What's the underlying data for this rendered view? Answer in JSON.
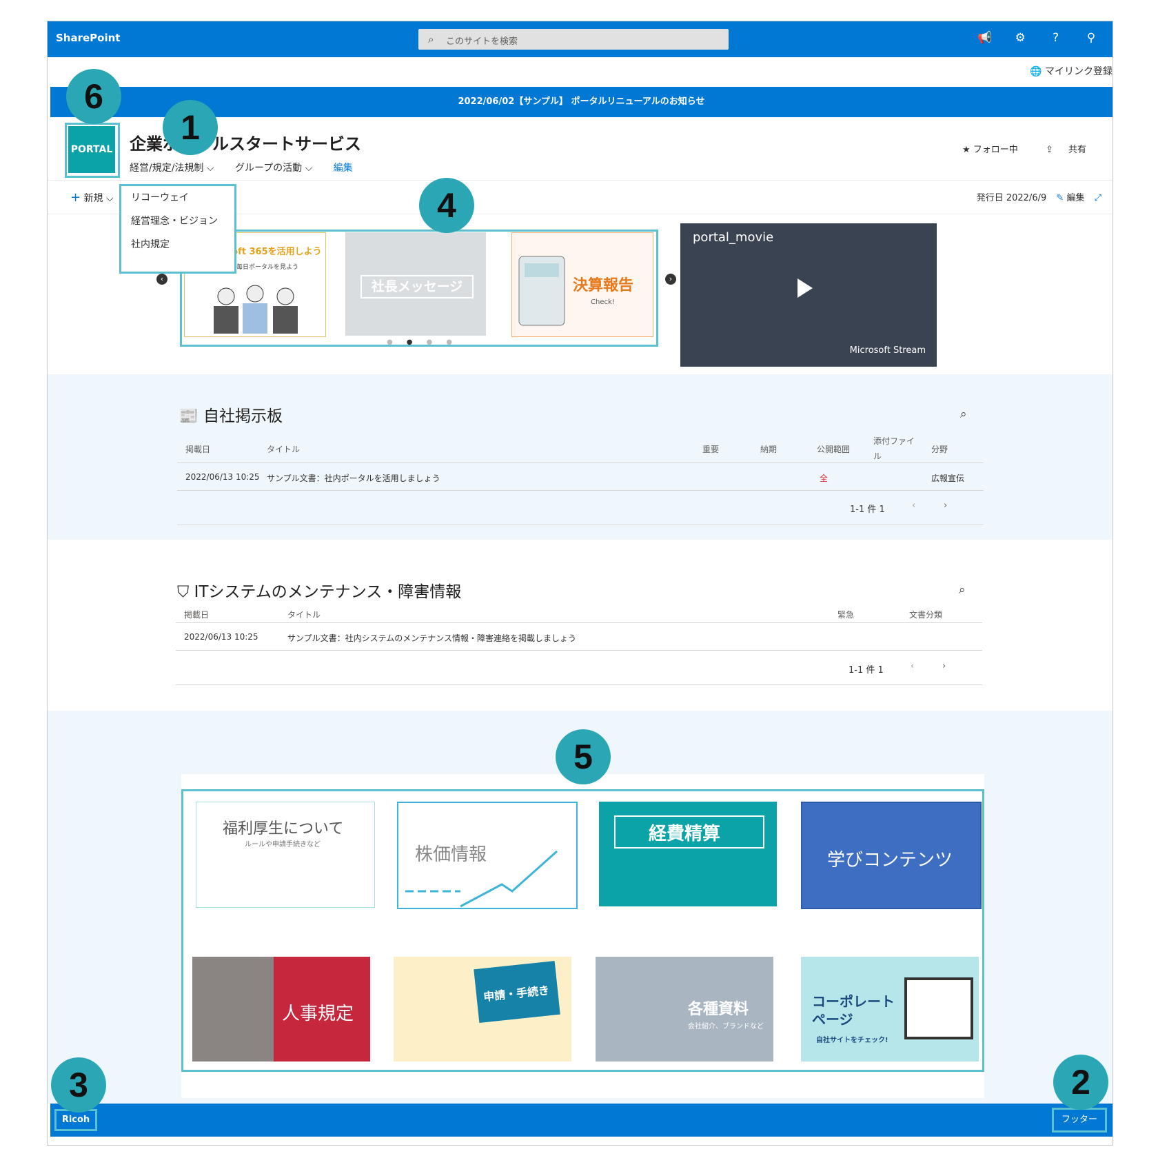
{
  "suitebar": {
    "brand": "SharePoint",
    "search_placeholder": "このサイトを検索"
  },
  "mylink": "マイリンク登録",
  "banner": "2022/06/02【サンプル】 ポータルリニューアルのお知らせ",
  "site": {
    "logo_text": "PORTAL",
    "title": "企業ポータルスタートサービス",
    "nav": [
      "経営/規定/法規制 ⌵",
      "グループの活動 ⌵"
    ],
    "nav_edit": "編集",
    "follow": "★ フォロー中",
    "share": "共有"
  },
  "cmdbar": {
    "new": "新規 ⌵",
    "published": "発行日 2022/6/9",
    "edit": "編集"
  },
  "dropdown": [
    "リコーウェイ",
    "経営理念・ビジョン",
    "社内規定"
  ],
  "carousel": {
    "slide1_title": "Microsoft 365を活用しよう",
    "slide1_sub": "まずは毎日ポータルを見よう",
    "slide2_title": "社長メッセージ",
    "slide3_title": "決算報告",
    "slide3_sub": "Check!"
  },
  "video": {
    "title": "portal_movie",
    "source": "Microsoft Stream"
  },
  "bulletin": {
    "title": "自社掲示板",
    "headers": [
      "掲載日",
      "タイトル",
      "重要",
      "納期",
      "公開範囲",
      "添付ファイル",
      "分野"
    ],
    "row": {
      "date": "2022/06/13 10:25",
      "title": "サンプル文書：社内ポータルを活用しましょう",
      "scope": "全",
      "field": "広報宣伝"
    },
    "pager": "1-1 件 1"
  },
  "it": {
    "title": "ITシステムのメンテナンス・障害情報",
    "headers": [
      "掲載日",
      "タイトル",
      "緊急",
      "文書分類"
    ],
    "row": {
      "date": "2022/06/13 10:25",
      "title": "サンプル文書：社内システムのメンテナンス情報・障害連絡を掲載しましょう"
    },
    "pager": "1-1 件 1"
  },
  "tiles": [
    {
      "label": "福利厚生について",
      "sub": "ルールや申請手続きなど"
    },
    {
      "label": "株価情報"
    },
    {
      "label": "経費精算"
    },
    {
      "label": "学びコンテンツ"
    },
    {
      "label": "人事規定"
    },
    {
      "label": "申請・手続き"
    },
    {
      "label": "各種資料",
      "sub": "会社紹介、ブランドなど"
    },
    {
      "label": "コーポレートページ",
      "sub": "自社サイトをチェック!"
    }
  ],
  "footer": {
    "left": "Ricoh",
    "right": "フッター"
  },
  "badges": [
    "1",
    "2",
    "3",
    "4",
    "5",
    "6"
  ],
  "colors": {
    "primary": "#0078d4",
    "highlight": "#5bc0cf",
    "badge": "#2aa6b5",
    "logo": "#0ba3a8"
  }
}
